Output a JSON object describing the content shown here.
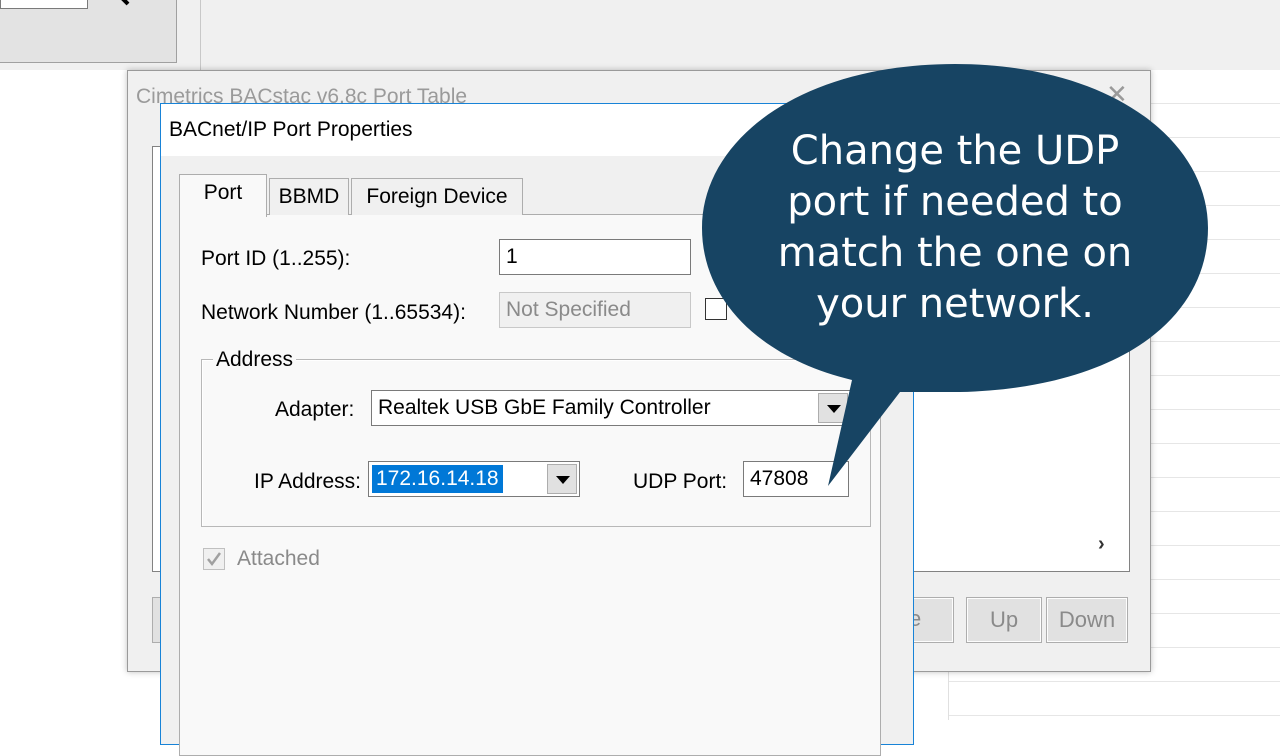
{
  "port_table_window": {
    "title": "Cimetrics BACstac v6.8c Port Table",
    "partial_button_label": "e",
    "up_button": "Up",
    "down_button": "Down",
    "scroll_right_icon": "›"
  },
  "dialog": {
    "title": "BACnet/IP Port Properties",
    "tabs": [
      {
        "label": "Port",
        "selected": true
      },
      {
        "label": "BBMD",
        "selected": false
      },
      {
        "label": "Foreign Device",
        "selected": false
      }
    ],
    "port_id_label": "Port ID (1..255):",
    "port_id_value": "1",
    "network_number_label": "Network Number (1..65534):",
    "network_number_value": "Not Specified",
    "address_group_label": "Address",
    "adapter_label": "Adapter:",
    "adapter_value": "Realtek USB GbE Family Controller",
    "ip_address_label": "IP Address:",
    "ip_address_value": "172.16.14.18",
    "udp_port_label": "UDP Port:",
    "udp_port_value": "47808",
    "attached_label": "Attached"
  },
  "callout": {
    "text": "Change the UDP port if needed to match the one on your network.",
    "lines": [
      "Change the UDP",
      "port if needed to",
      "match the one on",
      "your network."
    ],
    "fill_color": "#174463"
  }
}
